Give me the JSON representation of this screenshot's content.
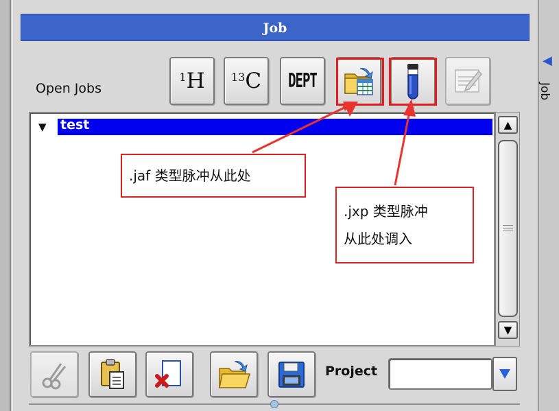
{
  "panel": {
    "title": "Job",
    "open_jobs_label": "Open Jobs",
    "side_tab_label": "Job"
  },
  "toolbar": {
    "h1_label": "H",
    "h1_sup": "1",
    "c13_label": "C",
    "c13_sup": "13",
    "dept_label": "DEPT"
  },
  "jobs": {
    "items": [
      {
        "label": "test",
        "expanded": true,
        "selected": true
      }
    ]
  },
  "annotations": {
    "jaf_note": ".jaf 类型脉冲从此处",
    "jxp_note_line1": ".jxp 类型脉冲",
    "jxp_note_line2": "从此处调入"
  },
  "bottom_bar": {
    "project_label": "Project",
    "project_value": ""
  },
  "colors": {
    "title_bar": "#3d64c8",
    "selection": "#0000ee",
    "annotation_red": "#e02020"
  }
}
